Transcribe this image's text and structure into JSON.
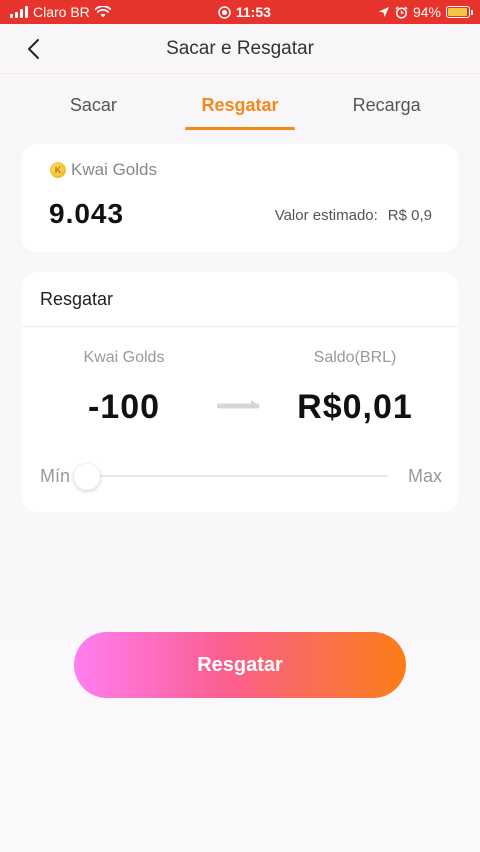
{
  "status_bar": {
    "carrier": "Claro BR",
    "time": "11:53",
    "battery_percent": "94%",
    "battery_level": 0.94,
    "icons": [
      "signal-icon",
      "wifi-icon",
      "screen-record-icon",
      "location-icon",
      "alarm-icon",
      "battery-icon"
    ]
  },
  "header": {
    "title": "Sacar e Resgatar",
    "back_icon": "chevron-left-icon"
  },
  "tabs": [
    {
      "label": "Sacar",
      "active": false
    },
    {
      "label": "Resgatar",
      "active": true
    },
    {
      "label": "Recarga",
      "active": false
    }
  ],
  "balance": {
    "label": "Kwai Golds",
    "value": "9.043",
    "estimate_label": "Valor estimado:",
    "estimate_value": "R$ 0,9"
  },
  "redeem": {
    "title": "Resgatar",
    "from_label": "Kwai Golds",
    "from_value": "-100",
    "to_label": "Saldo(BRL)",
    "to_value": "R$0,01",
    "slider_min_label": "Mín",
    "slider_max_label": "Max",
    "slider_level": 0.0
  },
  "button": {
    "label": "Resgatar"
  },
  "colors": {
    "accent": "#f08a1c",
    "status_bar": "#e6342c",
    "button_gradient": [
      "#ff7ef2",
      "#fb5f8f",
      "#fb7d16"
    ]
  }
}
